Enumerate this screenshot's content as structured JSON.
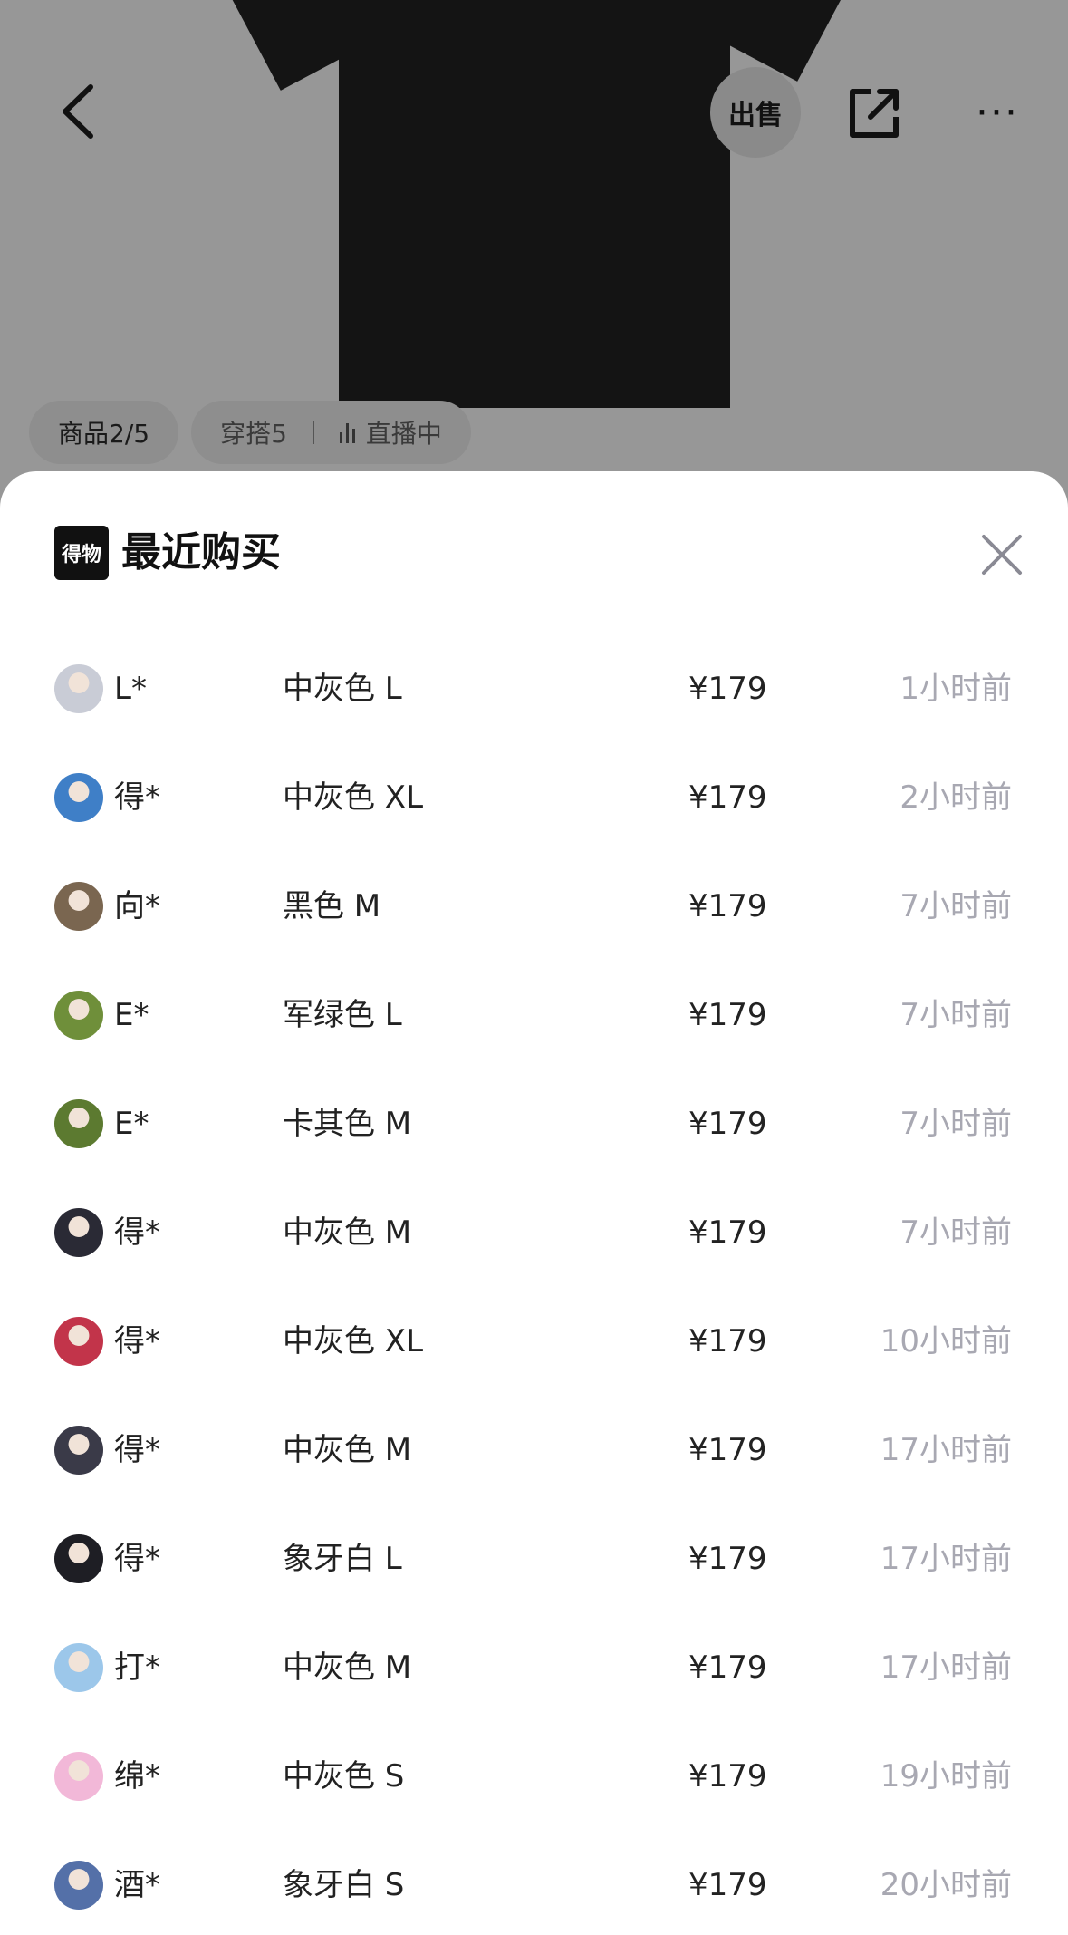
{
  "header": {
    "sell_label": "出售",
    "more_label": "···"
  },
  "tabs": {
    "product": "商品2/5",
    "outfit": "穿搭5",
    "live": "直播中"
  },
  "sheet": {
    "logo_text": "得物",
    "title": "最近购买"
  },
  "purchases": [
    {
      "user": "L*",
      "variant": "中灰色 L",
      "price": "¥179",
      "time": "1小时前",
      "avatar_color": "#c9ccd6"
    },
    {
      "user": "得*",
      "variant": "中灰色 XL",
      "price": "¥179",
      "time": "2小时前",
      "avatar_color": "#3f7fc7"
    },
    {
      "user": "向*",
      "variant": "黑色 M",
      "price": "¥179",
      "time": "7小时前",
      "avatar_color": "#7a6650"
    },
    {
      "user": "E*",
      "variant": "军绿色 L",
      "price": "¥179",
      "time": "7小时前",
      "avatar_color": "#6f8f3a"
    },
    {
      "user": "E*",
      "variant": "卡其色 M",
      "price": "¥179",
      "time": "7小时前",
      "avatar_color": "#5c7a30"
    },
    {
      "user": "得*",
      "variant": "中灰色 M",
      "price": "¥179",
      "time": "7小时前",
      "avatar_color": "#2a2a35"
    },
    {
      "user": "得*",
      "variant": "中灰色 XL",
      "price": "¥179",
      "time": "10小时前",
      "avatar_color": "#c2344a"
    },
    {
      "user": "得*",
      "variant": "中灰色 M",
      "price": "¥179",
      "time": "17小时前",
      "avatar_color": "#3a3a48"
    },
    {
      "user": "得*",
      "variant": "象牙白 L",
      "price": "¥179",
      "time": "17小时前",
      "avatar_color": "#1e1e24"
    },
    {
      "user": "打*",
      "variant": "中灰色 M",
      "price": "¥179",
      "time": "17小时前",
      "avatar_color": "#9cc7ea"
    },
    {
      "user": "绵*",
      "variant": "中灰色 S",
      "price": "¥179",
      "time": "19小时前",
      "avatar_color": "#f2b8d8"
    },
    {
      "user": "酒*",
      "variant": "象牙白 S",
      "price": "¥179",
      "time": "20小时前",
      "avatar_color": "#5470a8"
    }
  ]
}
